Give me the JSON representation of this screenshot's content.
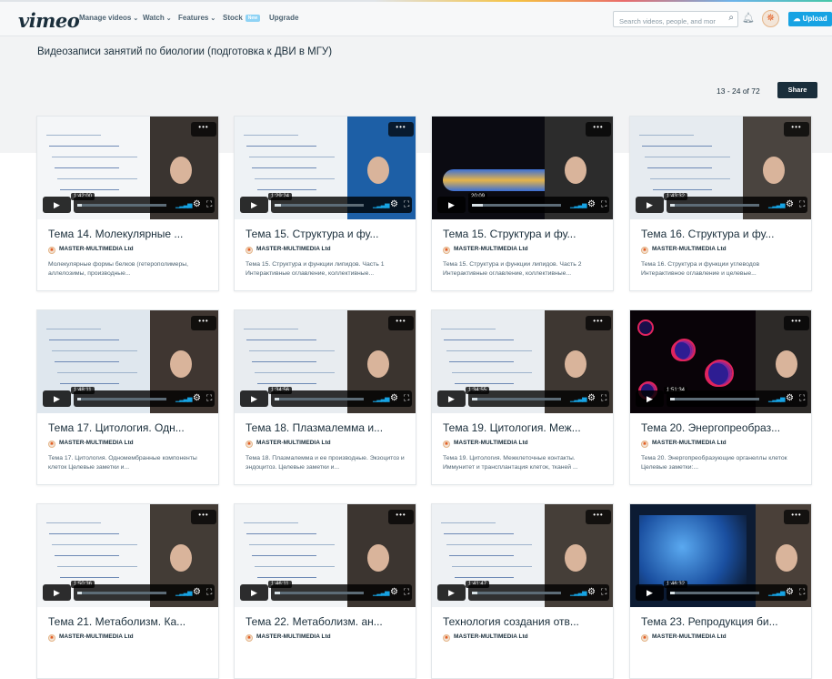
{
  "nav": {
    "logo": "vimeo",
    "items": [
      {
        "label": "Manage videos"
      },
      {
        "label": "Watch"
      },
      {
        "label": "Features"
      },
      {
        "label": "Stock"
      },
      {
        "label": "Upgrade"
      }
    ],
    "stock_badge": "New",
    "search_placeholder": "Search videos, people, and more",
    "upload_label": "Upload"
  },
  "page": {
    "title": "Видеозаписи занятий по биологии (подготовка к ДВИ в МГУ)",
    "range": "13 - 24 of 72",
    "share_label": "Share"
  },
  "videos": [
    {
      "duration": "1:42:00",
      "title": "Тема 14. Молекулярные ...",
      "owner": "MASTER-MULTIMEDIA Ltd",
      "desc": "Молекулярные формы белков (гетерополимеры, аллелозимы, производные..."
    },
    {
      "duration": "1:29:24",
      "title": "Тема 15. Структура и фу...",
      "owner": "MASTER-MULTIMEDIA Ltd",
      "desc": "Тема 15. Структура и функции липидов. Часть 1 Интерактивные оглавление, коллективные..."
    },
    {
      "duration": "20:09",
      "title": "Тема 15. Структура и фу...",
      "owner": "MASTER-MULTIMEDIA Ltd",
      "desc": "Тема 15. Структура и функции липидов. Часть 2 Интерактивные оглавление, коллективные..."
    },
    {
      "duration": "1:43:32",
      "title": "Тема 16. Структура и фу...",
      "owner": "MASTER-MULTIMEDIA Ltd",
      "desc": "Тема 16. Структура и функции углеводов Интерактивное оглавление и целевые..."
    },
    {
      "duration": "1:48:11",
      "title": "Тема 17. Цитология. Одн...",
      "owner": "MASTER-MULTIMEDIA Ltd",
      "desc": "Тема 17. Цитология. Одномембранные компоненты клеток Целевые заметки и..."
    },
    {
      "duration": "1:34:56",
      "title": "Тема 18. Плазмалемма и...",
      "owner": "MASTER-MULTIMEDIA Ltd",
      "desc": "Тема 18. Плазмалемма и ее производные. Экзоцитоз и эндоцитоз. Целевые заметки и..."
    },
    {
      "duration": "1:34:55",
      "title": "Тема 19. Цитология. Меж...",
      "owner": "MASTER-MULTIMEDIA Ltd",
      "desc": "Тема 19. Цитология. Межклеточные контакты. Иммунитет и трансплантация клеток, тканей ..."
    },
    {
      "duration": "1:51:34",
      "title": "Тема 20. Энергопреобраз...",
      "owner": "MASTER-MULTIMEDIA Ltd",
      "desc": "Тема 20. Энергопреобразующие органеллы клеток Целевые заметки:..."
    },
    {
      "duration": "1:50:36",
      "title": "Тема 21. Метаболизм. Ка...",
      "owner": "MASTER-MULTIMEDIA Ltd",
      "desc": ""
    },
    {
      "duration": "1:46:11",
      "title": "Тема 22. Метаболизм. ан...",
      "owner": "MASTER-MULTIMEDIA Ltd",
      "desc": ""
    },
    {
      "duration": "1:41:47",
      "title": "Технология создания отв...",
      "owner": "MASTER-MULTIMEDIA Ltd",
      "desc": ""
    },
    {
      "duration": "1:46:32",
      "title": "Тема 23. Репродукция би...",
      "owner": "MASTER-MULTIMEDIA Ltd",
      "desc": ""
    }
  ]
}
